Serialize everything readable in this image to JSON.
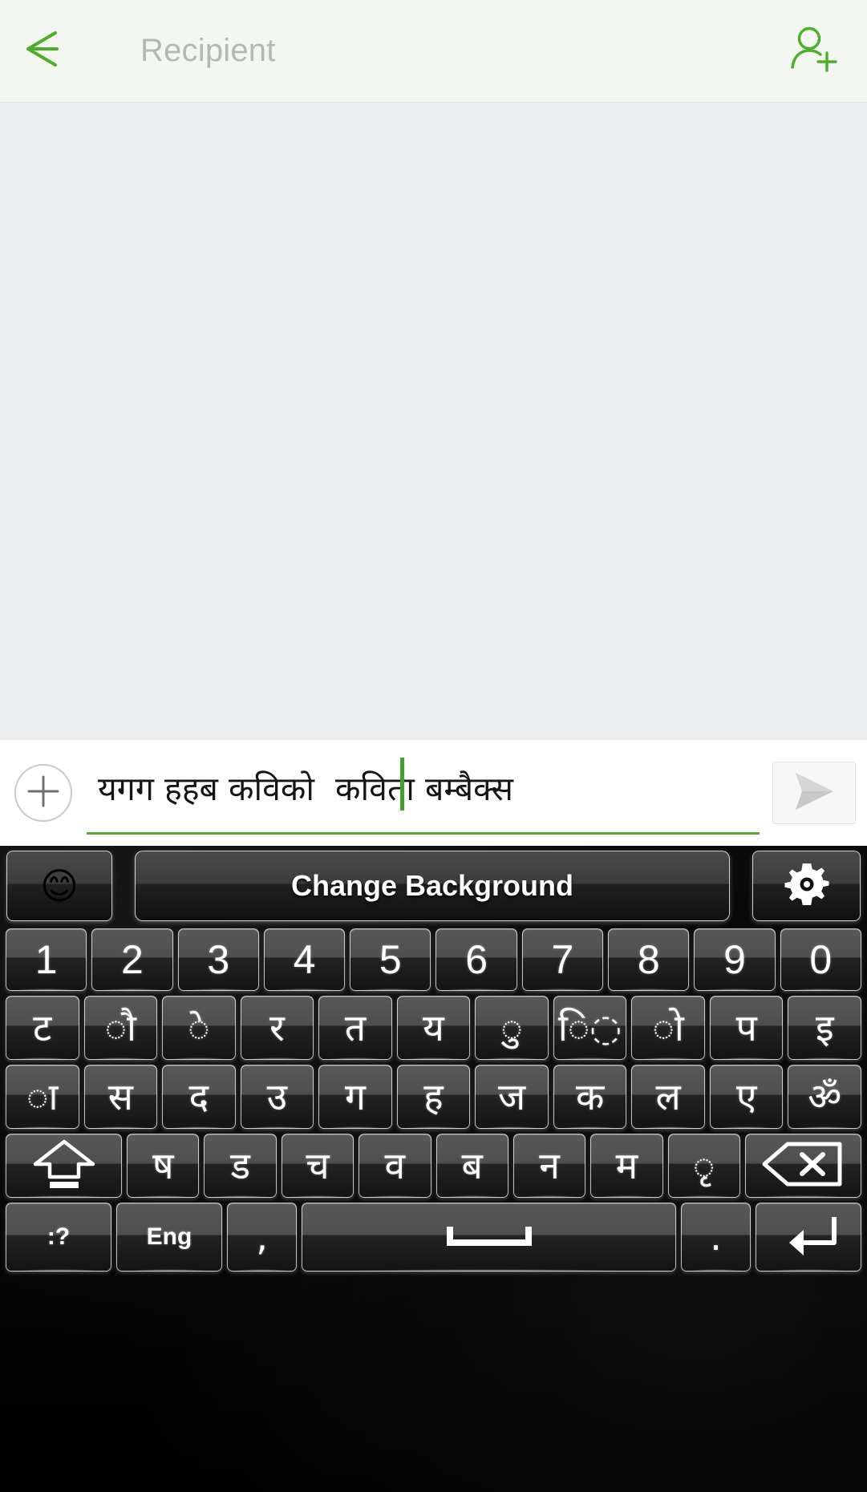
{
  "header": {
    "back_icon": "back-arrow-icon",
    "recipient_placeholder": "Recipient",
    "add_contact_icon": "add-contact-icon",
    "accent_color": "#4caf28",
    "background": "#f4f6f2"
  },
  "conversation": {
    "background": "#ebecee",
    "messages": []
  },
  "compose": {
    "attach_icon": "plus-icon",
    "message_value": "यगग हहब कविको  कविता बम्बैक्स",
    "message_placeholder": "",
    "underline_color": "#58a733",
    "caret_color": "#43a02a",
    "send_icon": "send-icon"
  },
  "keyboard": {
    "toolbar": {
      "emoji_label": "😊",
      "emoji_icon": "emoji-smiley-icon",
      "change_background_label": "Change Background",
      "settings_icon": "gear-icon"
    },
    "rows": [
      {
        "name": "number-row",
        "keys": [
          {
            "label": "1",
            "type": "num"
          },
          {
            "label": "2",
            "type": "num"
          },
          {
            "label": "3",
            "type": "num"
          },
          {
            "label": "4",
            "type": "num"
          },
          {
            "label": "5",
            "type": "num"
          },
          {
            "label": "6",
            "type": "num"
          },
          {
            "label": "7",
            "type": "num"
          },
          {
            "label": "8",
            "type": "num"
          },
          {
            "label": "9",
            "type": "num"
          },
          {
            "label": "0",
            "type": "num"
          }
        ]
      },
      {
        "name": "letter-row-1",
        "keys": [
          {
            "label": "ट",
            "type": "dev"
          },
          {
            "label": "◌ौ",
            "type": "dev"
          },
          {
            "label": "◌े",
            "type": "dev"
          },
          {
            "label": "र",
            "type": "dev"
          },
          {
            "label": "त",
            "type": "dev"
          },
          {
            "label": "य",
            "type": "dev"
          },
          {
            "label": "◌ु",
            "type": "dev"
          },
          {
            "label": "ि◌",
            "type": "dev"
          },
          {
            "label": "◌ो",
            "type": "dev"
          },
          {
            "label": "प",
            "type": "dev"
          },
          {
            "label": "इ",
            "type": "dev"
          }
        ]
      },
      {
        "name": "letter-row-2",
        "keys": [
          {
            "label": "◌ा",
            "type": "dev"
          },
          {
            "label": "स",
            "type": "dev"
          },
          {
            "label": "द",
            "type": "dev"
          },
          {
            "label": "उ",
            "type": "dev"
          },
          {
            "label": "ग",
            "type": "dev"
          },
          {
            "label": "ह",
            "type": "dev"
          },
          {
            "label": "ज",
            "type": "dev"
          },
          {
            "label": "क",
            "type": "dev"
          },
          {
            "label": "ल",
            "type": "dev"
          },
          {
            "label": "ए",
            "type": "dev"
          },
          {
            "label": "ॐ",
            "type": "dev"
          }
        ]
      },
      {
        "name": "letter-row-3",
        "keys": [
          {
            "label": "",
            "type": "shift",
            "icon": "shift-up-arrow-icon"
          },
          {
            "label": "ष",
            "type": "dev"
          },
          {
            "label": "ड",
            "type": "dev"
          },
          {
            "label": "च",
            "type": "dev"
          },
          {
            "label": "व",
            "type": "dev"
          },
          {
            "label": "ब",
            "type": "dev"
          },
          {
            "label": "न",
            "type": "dev"
          },
          {
            "label": "म",
            "type": "dev"
          },
          {
            "label": "◌ृ",
            "type": "dev"
          },
          {
            "label": "",
            "type": "backspace",
            "icon": "backspace-icon"
          }
        ]
      },
      {
        "name": "bottom-row",
        "keys": [
          {
            "label": ":?",
            "type": "small"
          },
          {
            "label": "Eng",
            "type": "small"
          },
          {
            "label": ",",
            "type": "dev"
          },
          {
            "label": "",
            "type": "space",
            "icon": "space-icon"
          },
          {
            "label": ".",
            "type": "dev"
          },
          {
            "label": "",
            "type": "enter",
            "icon": "enter-return-icon"
          }
        ]
      }
    ]
  }
}
